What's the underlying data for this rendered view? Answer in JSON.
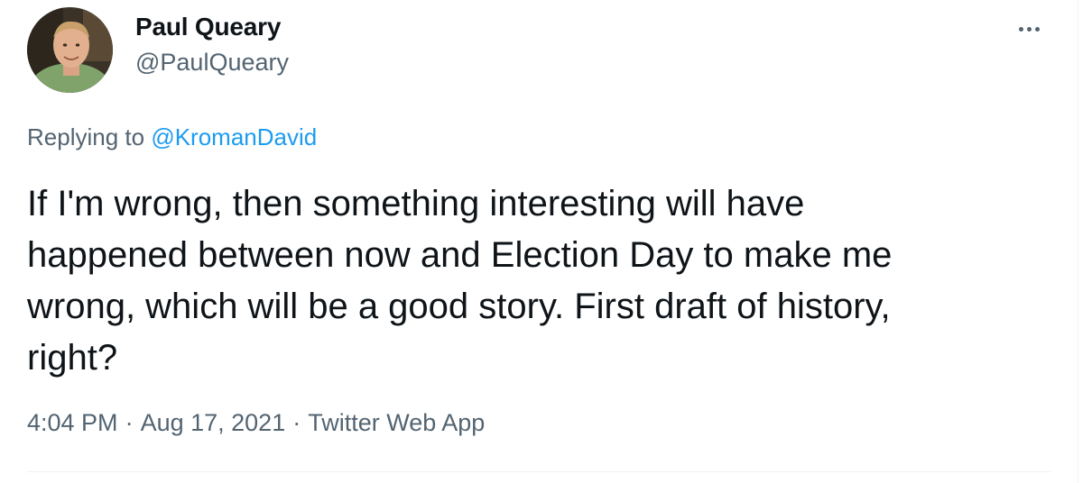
{
  "author": {
    "display_name": "Paul Queary",
    "handle": "@PaulQueary",
    "avatar": "profile-photo"
  },
  "more_icon": "more-horizontal-icon",
  "reply": {
    "prefix": "Replying to ",
    "mention": "@KromanDavid"
  },
  "tweet": {
    "lines": [
      "If I'm wrong, then something interesting will have",
      "happened between now and Election Day to make me",
      "wrong, which will be a good story. First draft of history,",
      "right?"
    ]
  },
  "meta": {
    "time": "4:04 PM",
    "separator": "·",
    "date": "Aug 17, 2021",
    "source": "Twitter Web App"
  },
  "colors": {
    "text": "#0f1419",
    "secondary": "#536471",
    "link": "#1d9bf0",
    "border": "#eff3f4"
  }
}
